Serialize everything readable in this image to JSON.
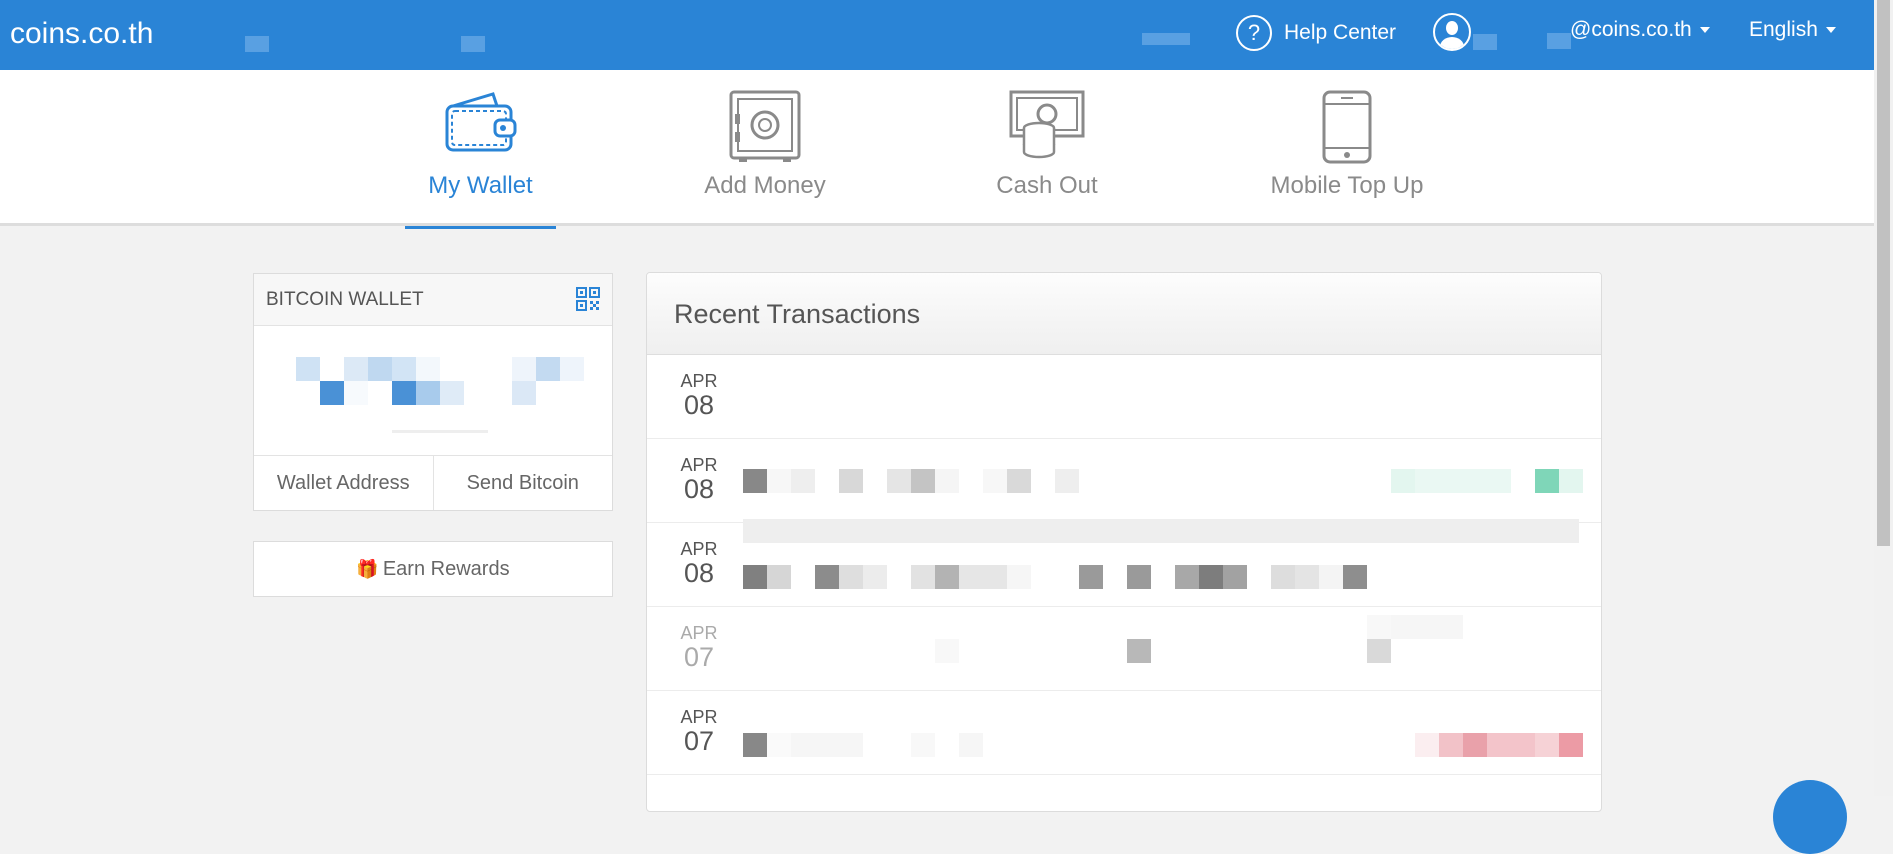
{
  "topbar": {
    "brand": "coins.co.th",
    "help_label": "Help Center",
    "help_icon": "?",
    "email_suffix": "@coins.co.th",
    "language": "English"
  },
  "tabs": [
    {
      "label": "My Wallet",
      "icon": "wallet-icon",
      "active": true
    },
    {
      "label": "Add Money",
      "icon": "safe-icon",
      "active": false
    },
    {
      "label": "Cash Out",
      "icon": "cash-icon",
      "active": false
    },
    {
      "label": "Mobile Top Up",
      "icon": "phone-icon",
      "active": false
    }
  ],
  "wallet": {
    "title": "BITCOIN WALLET",
    "address_label": "Wallet Address",
    "send_label": "Send Bitcoin"
  },
  "rewards": {
    "label": "Earn Rewards"
  },
  "recent": {
    "title": "Recent Transactions",
    "rows": [
      {
        "month": "APR",
        "day": "08"
      },
      {
        "month": "APR",
        "day": "08"
      },
      {
        "month": "APR",
        "day": "08"
      },
      {
        "month": "APR",
        "day": "07"
      },
      {
        "month": "APR",
        "day": "07"
      }
    ]
  },
  "colors": {
    "brand": "#2a84d6",
    "credit": "#7fd6b8",
    "debit": "#e88a95"
  }
}
